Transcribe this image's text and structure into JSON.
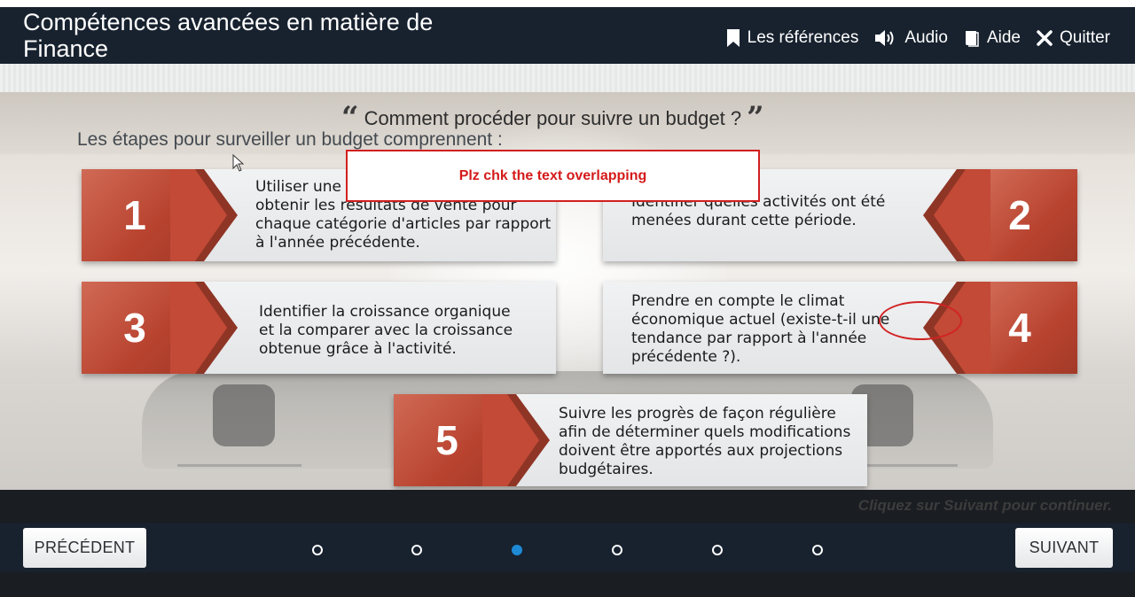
{
  "header": {
    "title": "Compétences avancées en matière de Finance",
    "nav": [
      {
        "label": "Les références",
        "icon": "bookmark-icon"
      },
      {
        "label": "Audio",
        "icon": "speaker-icon"
      },
      {
        "label": "Aide",
        "icon": "book-icon"
      },
      {
        "label": "Quitter",
        "icon": "close-icon"
      }
    ]
  },
  "content": {
    "question": "Comment procéder pour suivre un budget ?",
    "subtitle": "Les étapes pour surveiller un budget comprennent :",
    "steps": [
      {
        "number": "1",
        "text": "Utiliser une méthode de suivi pour obtenir les résultats de vente pour chaque catégorie d'articles par rapport à l'année précédente."
      },
      {
        "number": "2",
        "text": "Identifier quelles activités ont été menées durant cette période."
      },
      {
        "number": "3",
        "text": "Identifier la croissance organique et la comparer avec la croissance obtenue grâce à l'activité."
      },
      {
        "number": "4",
        "text": "Prendre en compte le climat économique actuel (existe-t-il une tendance par rapport à l'année précédente ?)."
      },
      {
        "number": "5",
        "text": "Suivre les progrès de façon régulière afin de déterminer quels modifications doivent être apportés aux projections budgétaires."
      }
    ]
  },
  "review": {
    "note": "Plz chk the text overlapping"
  },
  "footer": {
    "continue_hint": "Cliquez sur Suivant pour continuer.",
    "prev_label": "PRÉCÉDENT",
    "next_label": "SUIVANT",
    "pages": 6,
    "active_page": 3
  },
  "colors": {
    "header_bg": "#18222f",
    "badge_red": "#b8432f",
    "active_dot": "#1e8ad6",
    "review_red": "#d21f1f"
  }
}
